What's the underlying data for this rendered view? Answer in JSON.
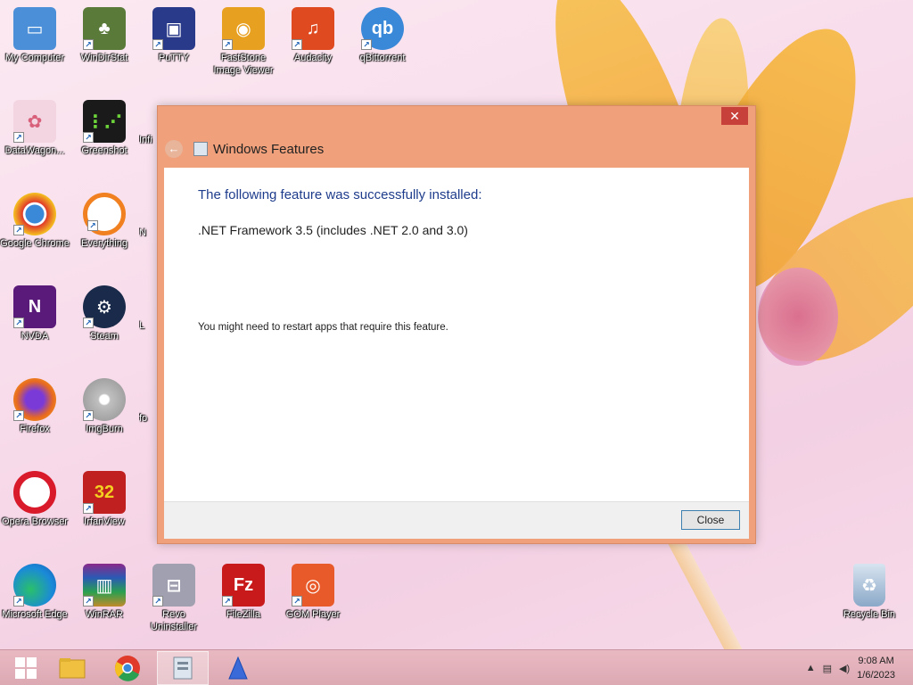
{
  "desktop_icons": [
    {
      "label": "My Computer",
      "icon": "computer-icon",
      "color": "#4a8fd8"
    },
    {
      "label": "WinDirStat",
      "icon": "tree-icon",
      "color": "#5a7a3a"
    },
    {
      "label": "PuTTY",
      "icon": "terminal-icon",
      "color": "#2a3a8a"
    },
    {
      "label": "FastStone Image Viewer",
      "icon": "eye-icon",
      "color": "#e8a020"
    },
    {
      "label": "Audacity",
      "icon": "audio-icon",
      "color": "#e04a20"
    },
    {
      "label": "qBittorrent",
      "icon": "qb-icon",
      "color": "#3a88d8"
    },
    {
      "label": "DataWagon...",
      "icon": "flower-icon",
      "color": "#d8607a"
    },
    {
      "label": "Greenshot",
      "icon": "greenshot-icon",
      "color": "#1a1a1a"
    },
    {
      "label": "Google Chrome",
      "icon": "chrome-icon",
      "color": "#3a88d8"
    },
    {
      "label": "Everything",
      "icon": "search-icon",
      "color": "#f08020"
    },
    {
      "label": "NVDA",
      "icon": "nvda-icon",
      "color": "#5a1a7a"
    },
    {
      "label": "Steam",
      "icon": "steam-icon",
      "color": "#1a2a4a"
    },
    {
      "label": "Firefox",
      "icon": "firefox-icon",
      "color": "#e86a20"
    },
    {
      "label": "ImgBurn",
      "icon": "disc-icon",
      "color": "#a0a0a0"
    },
    {
      "label": "Opera Browser",
      "icon": "opera-icon",
      "color": "#d81a2a"
    },
    {
      "label": "IrfanView",
      "icon": "irfanview-icon",
      "color": "#c02020"
    },
    {
      "label": "Microsoft Edge",
      "icon": "edge-icon",
      "color": "#1a8ad8"
    },
    {
      "label": "WinRAR",
      "icon": "archive-icon",
      "color": "#8a2a8a"
    },
    {
      "label": "Revo Uninstaller",
      "icon": "uninstall-icon",
      "color": "#a0a0b0"
    },
    {
      "label": "FileZilla",
      "icon": "filezilla-icon",
      "color": "#c81a1a"
    },
    {
      "label": "GOM Player",
      "icon": "player-icon",
      "color": "#e85a2a"
    },
    {
      "label": "Recycle Bin",
      "icon": "recycle-bin-icon",
      "color": "#8aa8c8"
    }
  ],
  "partial_labels": [
    "Infi",
    "N",
    "L",
    "fo"
  ],
  "dialog": {
    "title": "Windows Features",
    "close_glyph": "✕",
    "heading": "The following feature was successfully installed:",
    "feature": ".NET Framework 3.5 (includes .NET 2.0 and 3.0)",
    "note": "You might need to restart apps that require this feature.",
    "close_button": "Close"
  },
  "taskbar": {
    "items": [
      "start-icon",
      "file-explorer-icon",
      "chrome-icon",
      "control-panel-icon",
      "app-icon"
    ],
    "time": "9:08 AM",
    "date": "1/6/2023"
  }
}
